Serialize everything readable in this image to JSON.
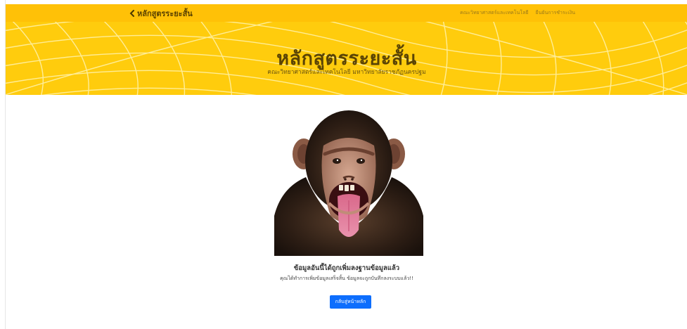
{
  "navbar": {
    "brand_label": "หลักสูตรระยะสั้น",
    "links": [
      {
        "label": "คณะวิทยาศาสตร์และเทคโนโลยี"
      },
      {
        "label": "ยืนยันการชำระเงิน"
      }
    ]
  },
  "hero": {
    "title": "หลักสูตรระยะสั้น",
    "subtitle": "คณะวิทยาศาสตร์และเทคโนโลยี มหาวิทยาลัยราชภัฏนครปฐม"
  },
  "message": {
    "title": "ข้อมูลอันนี้ได้ถูกเพิ่มลงฐานข้อมูลแล้ว",
    "subtitle": "คุณได้ทำการเพิ่มข้อมูลเสร็จสิ้น ข้อมูลจะถูกบันทึกลงระบบแล้ว!!"
  },
  "button": {
    "label": "กลับสู่หน้าหลัก"
  },
  "colors": {
    "navbar": "#ffc107",
    "hero": "#ffcc0d",
    "text_dark": "#5a4405",
    "primary": "#0d6efd"
  }
}
